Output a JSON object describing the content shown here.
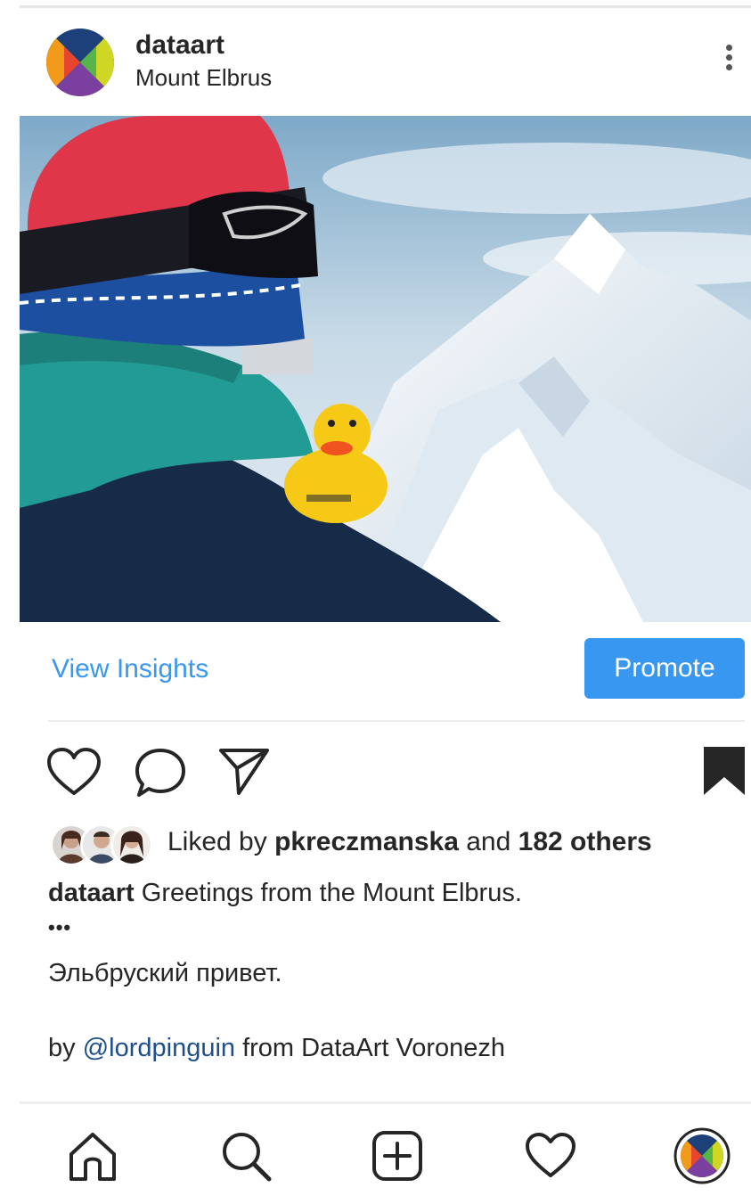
{
  "post": {
    "username": "dataart",
    "location": "Mount Elbrus"
  },
  "icons": {
    "avatar": "dataart-logo-icon",
    "more": "more-vertical-icon",
    "like": "heart-icon",
    "comment": "comment-icon",
    "share": "paper-plane-icon",
    "save": "bookmark-icon",
    "nav_home": "home-icon",
    "nav_search": "search-icon",
    "nav_add": "add-post-icon",
    "nav_activity": "heart-icon",
    "nav_profile": "profile-avatar-icon"
  },
  "insights": {
    "view_label": "View Insights",
    "promote_label": "Promote"
  },
  "likes": {
    "prefix": "Liked by",
    "user": "pkreczmanska",
    "conj": "and",
    "others": "182 others"
  },
  "caption": {
    "username": "dataart",
    "text": "Greetings from the Mount Elbrus.",
    "dots": "•••",
    "line2": "Эльбруский привет.",
    "by": "by",
    "mention": "@lordpinguin",
    "rest": "from DataArt Voronezh"
  },
  "colors": {
    "accent": "#3897f0",
    "mention": "#1f4e8c",
    "text": "#262626"
  }
}
